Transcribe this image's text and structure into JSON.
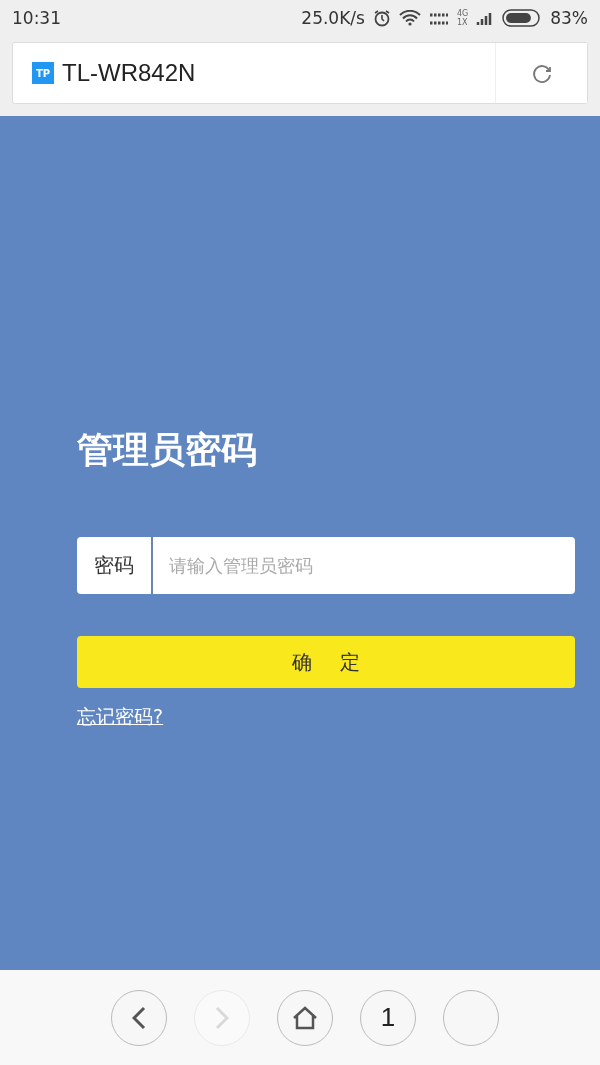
{
  "status_bar": {
    "time": "10:31",
    "speed": "25.0K/s",
    "network_small": [
      "4G",
      "1X"
    ],
    "battery": {
      "text": "83%",
      "level": 0.83
    }
  },
  "address_bar": {
    "title": "TL-WR842N",
    "logo": "TP"
  },
  "login": {
    "title": "管理员密码",
    "field_label": "密码",
    "placeholder": "请输入管理员密码",
    "submit": "确 定",
    "forgot_link": "忘记密码?"
  },
  "nav": [
    {
      "kind": "back",
      "disabled": false
    },
    {
      "kind": "forward",
      "disabled": true
    },
    {
      "kind": "home",
      "disabled": false
    },
    {
      "kind": "tabs",
      "disabled": false,
      "count": "1"
    },
    {
      "kind": "menu",
      "disabled": false
    }
  ]
}
